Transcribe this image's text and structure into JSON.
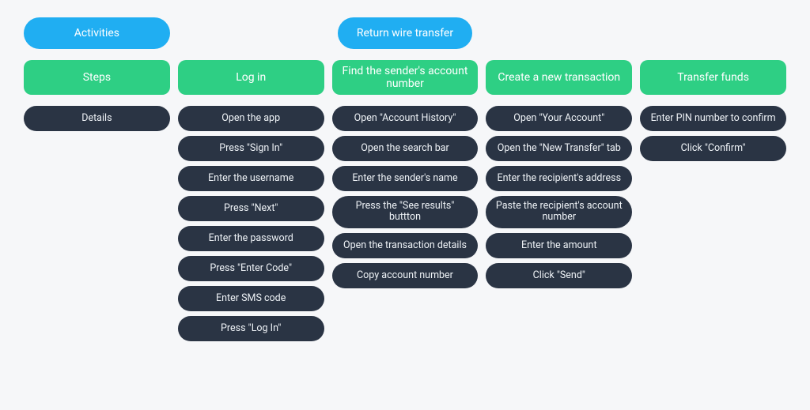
{
  "row_labels": {
    "activities": "Activities",
    "steps": "Steps",
    "details": "Details"
  },
  "activity_title": "Return wire transfer",
  "columns": [
    {
      "step": "Log in",
      "details": [
        "Open the app",
        "Press \"Sign In\"",
        "Enter the username",
        "Press \"Next\"",
        "Enter the password",
        "Press \"Enter Code\"",
        "Enter SMS code",
        "Press \"Log In\""
      ]
    },
    {
      "step": "Find the sender's account number",
      "details": [
        "Open \"Account History\"",
        "Open the search bar",
        "Enter the sender's name",
        "Press the \"See results\" buttton",
        "Open the transaction details",
        "Copy account number"
      ]
    },
    {
      "step": "Create a new transaction",
      "details": [
        "Open \"Your Account\"",
        "Open the \"New Transfer\" tab",
        "Enter the recipient's address",
        "Paste the recipient's account number",
        "Enter the amount",
        "Click \"Send\""
      ]
    },
    {
      "step": "Transfer funds",
      "details": [
        "Enter PIN number to confirm",
        "Click \"Confirm\""
      ]
    }
  ]
}
